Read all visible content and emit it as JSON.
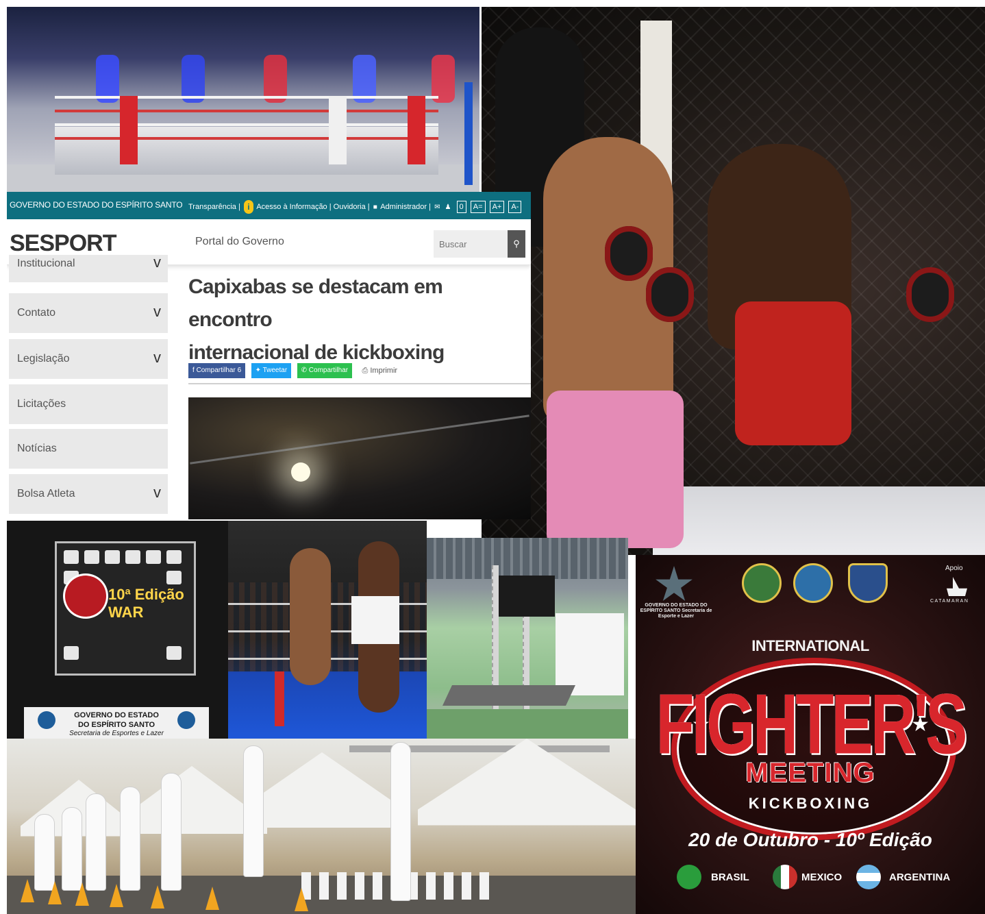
{
  "site": {
    "topbar": {
      "government": "GOVERNO DO ESTADO DO ESPÍRITO SANTO",
      "transparencia": "Transparência |",
      "acesso": "Acesso à Informação",
      "ouvidoria": "| Ouvidoria |",
      "administrador": "Administrador |",
      "contrast": "0",
      "font_reset": "A=",
      "font_plus": "A+",
      "font_minus": "A-"
    },
    "header": {
      "brand": "SESPORT",
      "portal_link": "Portal do Governo",
      "search_placeholder": "Buscar"
    },
    "sidebar": {
      "items": [
        {
          "label": "Institucional",
          "chevron": "v"
        },
        {
          "label": "Contato",
          "chevron": "v"
        },
        {
          "label": "Legislação",
          "chevron": "v"
        },
        {
          "label": "Licitações",
          "chevron": ""
        },
        {
          "label": "Notícias",
          "chevron": ""
        },
        {
          "label": "Bolsa Atleta",
          "chevron": "v"
        }
      ]
    },
    "article": {
      "title_line1": "Capixabas se destacam em encontro",
      "title_line2": "internacional de kickboxing",
      "share": {
        "facebook": "Compartilhar 6",
        "twitter": "Tweetar",
        "whatsapp": "Compartilhar",
        "print": "Imprimir"
      }
    }
  },
  "banner_table": {
    "line1": "GOVERNO DO ESTADO",
    "line2": "DO ESPÍRITO SANTO",
    "line3": "Secretaria de Esportes e Lazer"
  },
  "banner_board": {
    "edition": "10ª Edição",
    "war": "WAR"
  },
  "poster": {
    "gov_text": "GOVERNO DO ESTADO DO ESPÍRITO SANTO Secretaria de Esporte e Lazer",
    "apoio": "Apoio",
    "catamaran": "CATAMARAN",
    "international": "INTERNATIONAL",
    "fighters": "FIGHTER'S",
    "meeting": "MEETING",
    "kickboxing": "KICKBOXING",
    "date": "20 de Outubro - 10º Edição",
    "countries": [
      {
        "name": "BRASIL",
        "color": "#2a9d3c"
      },
      {
        "name": "MEXICO",
        "color": "#c9302c"
      },
      {
        "name": "ARGENTINA",
        "color": "#6cb4e4"
      }
    ]
  },
  "colors": {
    "topbar": "#0e6f80",
    "poster_red": "#d8262c",
    "facebook": "#3b5998",
    "twitter": "#1da1f2",
    "whatsapp": "#2cc04f"
  },
  "icons": {
    "info": "info-icon",
    "lock": "lock-icon",
    "search": "search-icon",
    "print": "printer-icon"
  }
}
